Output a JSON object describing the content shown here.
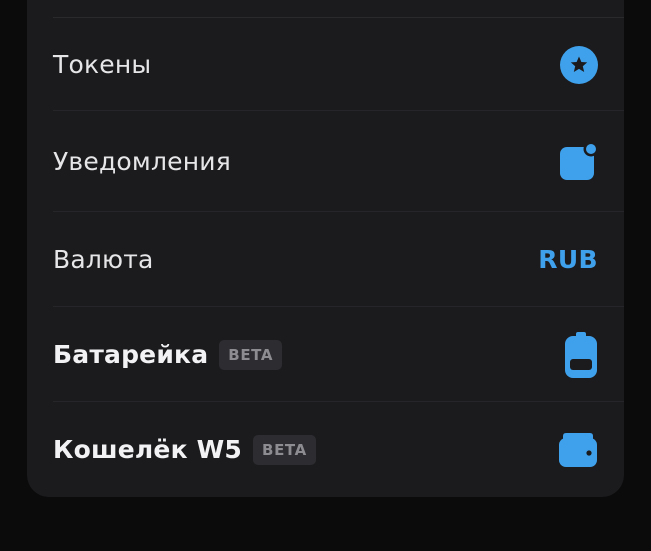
{
  "settings": {
    "items": [
      {
        "label": "Токены",
        "icon": "star-circle-icon"
      },
      {
        "label": "Уведомления",
        "icon": "notification-badge-icon"
      },
      {
        "label": "Валюта",
        "value": "RUB"
      },
      {
        "label": "Батарейка",
        "badge": "BETA",
        "icon": "battery-icon"
      },
      {
        "label": "Кошелёк W5",
        "badge": "BETA",
        "icon": "wallet-icon"
      }
    ]
  },
  "colors": {
    "background": "#0b0b0c",
    "card": "#1b1b1d",
    "accent": "#3fa1ec",
    "text": "#e6e6e8",
    "badge_bg": "#2d2d31",
    "badge_text": "#8c8c91"
  }
}
